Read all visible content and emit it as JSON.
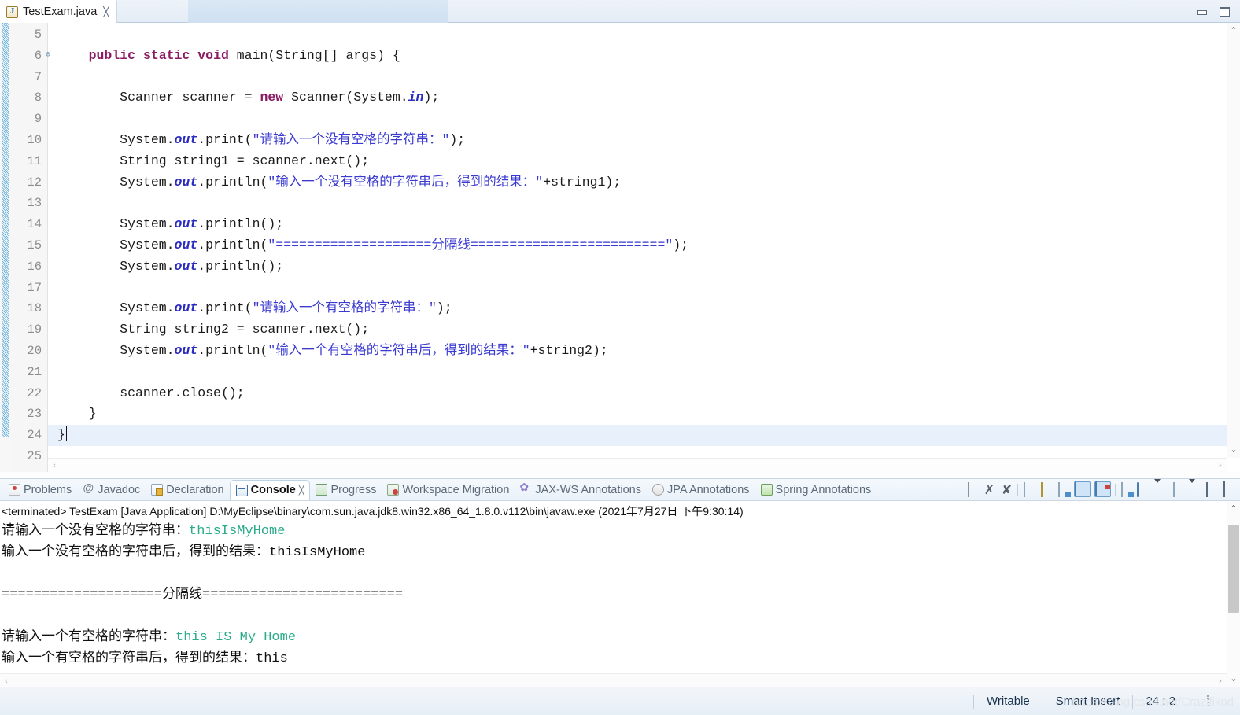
{
  "editor": {
    "tab": {
      "title": "TestExam.java",
      "icon": "java-file-icon",
      "close": "╳"
    },
    "window_controls": {
      "minimize": "minimize-icon",
      "maximize": "maximize-icon"
    },
    "first_visible_line": 5,
    "cursor_line": 24,
    "lines": [
      {
        "n": "5",
        "fold": false,
        "text": ""
      },
      {
        "n": "6",
        "fold": true,
        "text": "    public static void main(String[] args) {"
      },
      {
        "n": "7",
        "fold": false,
        "text": ""
      },
      {
        "n": "8",
        "fold": false,
        "text": "        Scanner scanner = new Scanner(System.in);"
      },
      {
        "n": "9",
        "fold": false,
        "text": ""
      },
      {
        "n": "10",
        "fold": false,
        "text": "        System.out.print(\"请输入一个没有空格的字符串：\");"
      },
      {
        "n": "11",
        "fold": false,
        "text": "        String string1 = scanner.next();"
      },
      {
        "n": "12",
        "fold": false,
        "text": "        System.out.println(\"输入一个没有空格的字符串后，得到的结果：\"+string1);"
      },
      {
        "n": "13",
        "fold": false,
        "text": ""
      },
      {
        "n": "14",
        "fold": false,
        "text": "        System.out.println();"
      },
      {
        "n": "15",
        "fold": false,
        "text": "        System.out.println(\"====================分隔线=========================\");"
      },
      {
        "n": "16",
        "fold": false,
        "text": "        System.out.println();"
      },
      {
        "n": "17",
        "fold": false,
        "text": ""
      },
      {
        "n": "18",
        "fold": false,
        "text": "        System.out.print(\"请输入一个有空格的字符串：\");"
      },
      {
        "n": "19",
        "fold": false,
        "text": "        String string2 = scanner.next();"
      },
      {
        "n": "20",
        "fold": false,
        "text": "        System.out.println(\"输入一个有空格的字符串后，得到的结果：\"+string2);"
      },
      {
        "n": "21",
        "fold": false,
        "text": ""
      },
      {
        "n": "22",
        "fold": false,
        "text": "        scanner.close();"
      },
      {
        "n": "23",
        "fold": false,
        "text": "    }"
      },
      {
        "n": "24",
        "fold": false,
        "text": "}"
      },
      {
        "n": "25",
        "fold": false,
        "text": ""
      }
    ],
    "scroll_up_arrow": "⌃",
    "scroll_down_arrow": "⌄",
    "scroll_left_arrow": "‹",
    "scroll_right_arrow": "›"
  },
  "view_tabs": [
    {
      "label": "Problems",
      "icon": "problems-icon",
      "selected": false
    },
    {
      "label": "Javadoc",
      "icon": "javadoc-icon",
      "selected": false
    },
    {
      "label": "Declaration",
      "icon": "declaration-icon",
      "selected": false
    },
    {
      "label": "Console",
      "icon": "console-icon",
      "selected": true,
      "close": "╳"
    },
    {
      "label": "Progress",
      "icon": "progress-icon",
      "selected": false
    },
    {
      "label": "Workspace Migration",
      "icon": "workspace-migration-icon",
      "selected": false
    },
    {
      "label": "JAX-WS Annotations",
      "icon": "jaxws-icon",
      "selected": false
    },
    {
      "label": "JPA Annotations",
      "icon": "jpa-icon",
      "selected": false
    },
    {
      "label": "Spring Annotations",
      "icon": "spring-icon",
      "selected": false
    }
  ],
  "console_toolbar": [
    {
      "name": "terminate-button",
      "pressed": false
    },
    {
      "name": "remove-launch-button",
      "pressed": false
    },
    {
      "name": "remove-all-launches-button",
      "pressed": false
    },
    {
      "name": "clear-console-button",
      "pressed": false
    },
    {
      "name": "scroll-lock-button",
      "pressed": false
    },
    {
      "name": "word-wrap-button",
      "pressed": false
    },
    {
      "name": "show-console-on-output-button",
      "pressed": true
    },
    {
      "name": "show-console-on-error-button",
      "pressed": true
    },
    {
      "name": "pin-console-button",
      "pressed": false
    },
    {
      "name": "display-selected-console-button",
      "pressed": false
    },
    {
      "name": "open-console-button",
      "pressed": false
    },
    {
      "name": "minimize-view-button",
      "pressed": false
    },
    {
      "name": "maximize-view-button",
      "pressed": false
    }
  ],
  "console": {
    "launch_header": "<terminated> TestExam [Java Application] D:\\MyEclipse\\binary\\com.sun.java.jdk8.win32.x86_64_1.8.0.v112\\bin\\javaw.exe (2021年7月27日 下午9:30:14)",
    "lines": [
      {
        "prompt": "请输入一个没有空格的字符串：",
        "input": "thisIsMyHome"
      },
      {
        "prompt": "输入一个没有空格的字符串后，得到的结果：thisIsMyHome",
        "input": ""
      },
      {
        "prompt": "",
        "input": ""
      },
      {
        "prompt": "====================分隔线=========================",
        "input": ""
      },
      {
        "prompt": "",
        "input": ""
      },
      {
        "prompt": "请输入一个有空格的字符串：",
        "input": "this IS My Home"
      },
      {
        "prompt": "输入一个有空格的字符串后，得到的结果：this",
        "input": ""
      }
    ],
    "input_color": "#2aab89"
  },
  "statusbar": {
    "writable": "Writable",
    "insert_mode": "Smart Insert",
    "position": "24 : 2"
  },
  "watermark": "https://blog.csdn.net/Crazifikod"
}
